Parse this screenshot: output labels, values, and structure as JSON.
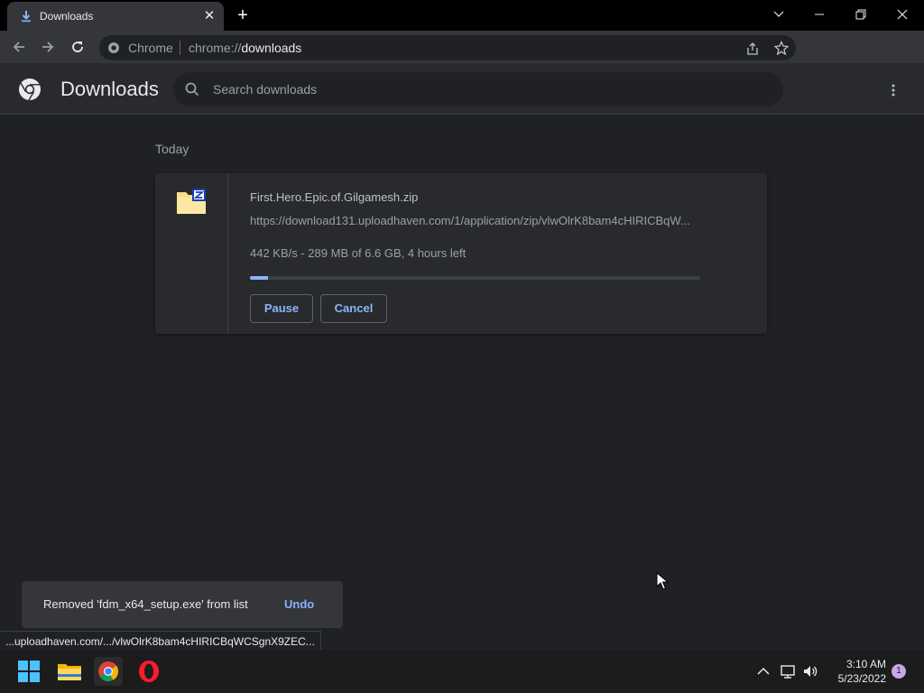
{
  "browser": {
    "tab": {
      "title": "Downloads",
      "favicon": "download-icon"
    },
    "window_controls": [
      "tab-search",
      "minimize",
      "restore",
      "close"
    ],
    "omnibox": {
      "site_chip": "Chrome",
      "url_prefix": "chrome://",
      "url_host": "downloads"
    }
  },
  "downloads_page": {
    "title": "Downloads",
    "search": {
      "placeholder": "Search downloads",
      "value": ""
    },
    "more_actions_icon": "more-vert-icon",
    "date_group": "Today",
    "items": [
      {
        "file_name": "First.Hero.Epic.of.Gilgamesh.zip",
        "url": "https://download131.uploadhaven.com/1/application/zip/vlwOlrK8bam4cHIRICBqW...",
        "status": "442 KB/s - 289 MB of 6.6 GB, 4 hours left",
        "progress": 0.04,
        "icon": "zip-file-icon",
        "pause_label": "Pause",
        "cancel_label": "Cancel"
      }
    ]
  },
  "toast": {
    "message": "Removed 'fdm_x64_setup.exe' from list",
    "action": "Undo"
  },
  "status_bubble": "...uploadhaven.com/.../vlwOlrK8bam4cHIRICBqWCSgnX9ZEC...",
  "taskbar": {
    "apps": [
      "windows-start-icon",
      "file-explorer-icon",
      "chrome-icon",
      "opera-icon"
    ],
    "time": "3:10 AM",
    "date": "5/23/2022",
    "notification_count": "1"
  },
  "colors": {
    "accent": "#8ab4f8",
    "background": "#202124",
    "surface": "#292a2d"
  }
}
